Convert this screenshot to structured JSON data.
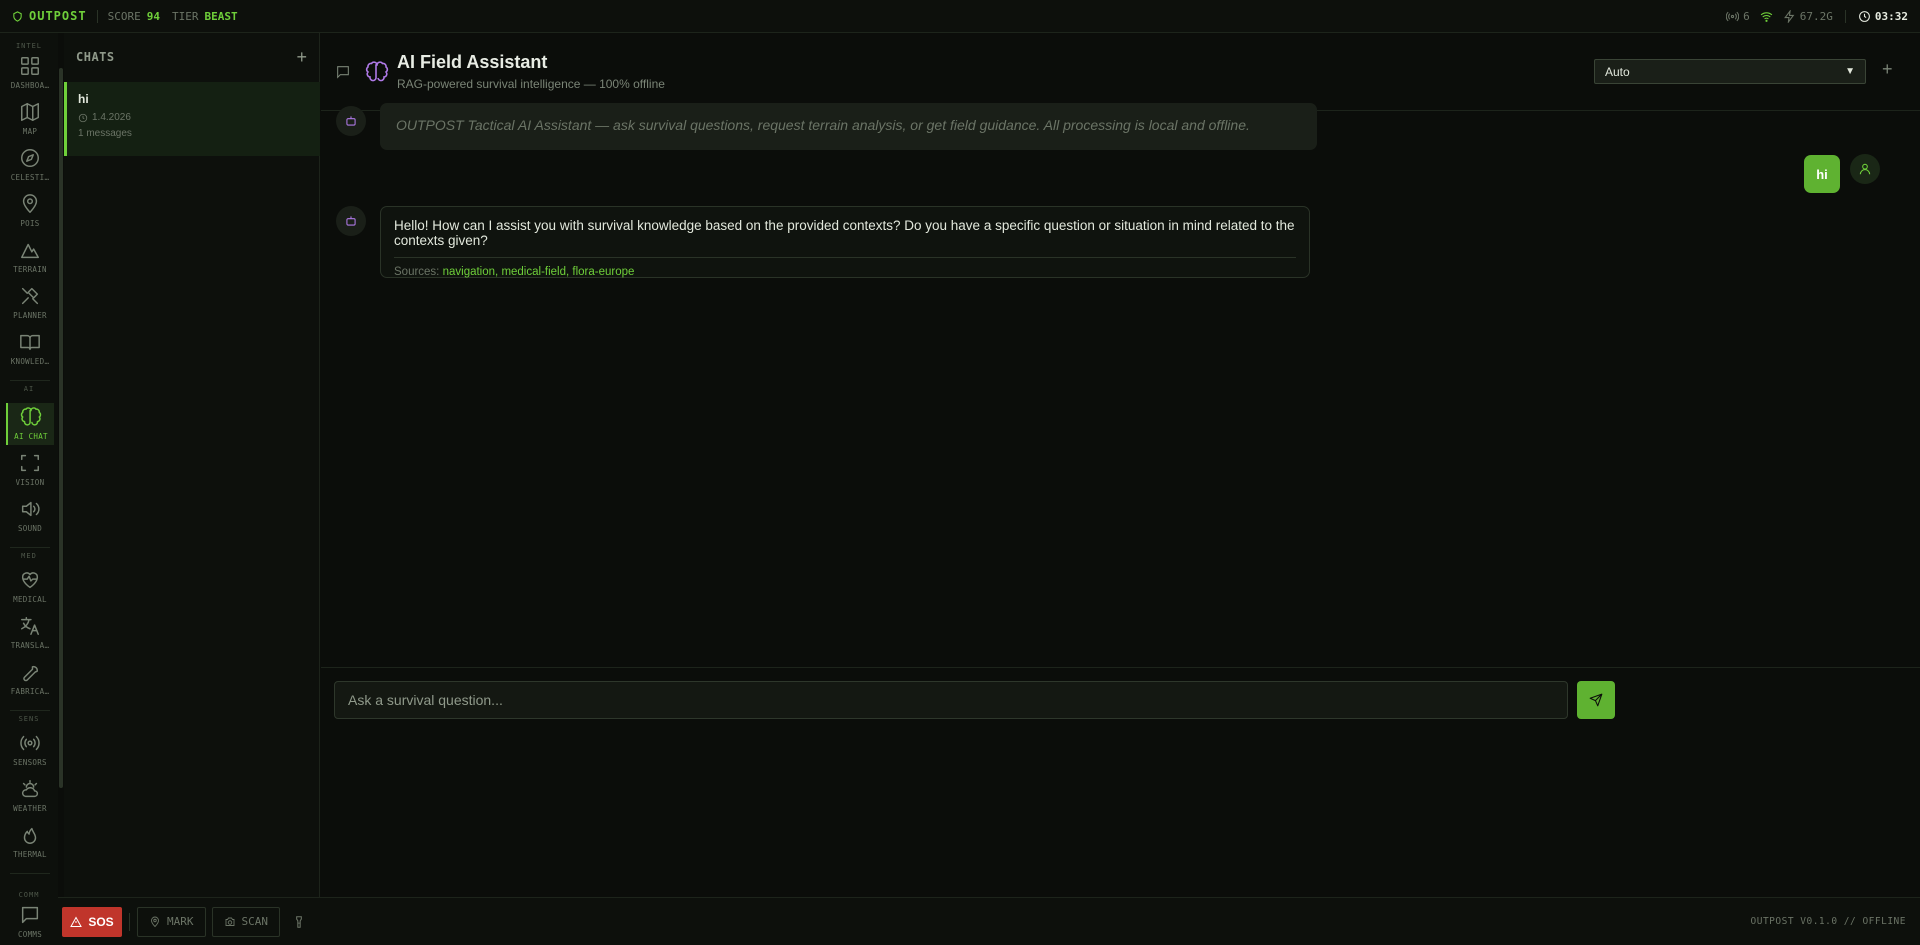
{
  "topbar": {
    "brand": "OUTPOST",
    "score_label": "SCORE",
    "score_value": "94",
    "tier_label": "TIER",
    "tier_value": "BEAST",
    "signal_count": "6",
    "power": "67.2G",
    "time": "03:32"
  },
  "rail": {
    "sections": [
      "INTEL",
      "AI",
      "MED",
      "SENS",
      "COMM"
    ],
    "items": [
      {
        "label": "DASHBOA…",
        "icon": "dashboard-icon"
      },
      {
        "label": "MAP",
        "icon": "map-icon"
      },
      {
        "label": "CELESTI…",
        "icon": "compass-icon"
      },
      {
        "label": "POIS",
        "icon": "pin-icon"
      },
      {
        "label": "TERRAIN",
        "icon": "mountain-icon"
      },
      {
        "label": "PLANNER",
        "icon": "tools-icon"
      },
      {
        "label": "KNOWLED…",
        "icon": "book-icon"
      },
      {
        "label": "AI CHAT",
        "icon": "brain-icon"
      },
      {
        "label": "VISION",
        "icon": "scan-icon"
      },
      {
        "label": "SOUND",
        "icon": "speaker-icon"
      },
      {
        "label": "MEDICAL",
        "icon": "heart-pulse-icon"
      },
      {
        "label": "TRANSLA…",
        "icon": "translate-icon"
      },
      {
        "label": "FABRICA…",
        "icon": "wrench-icon"
      },
      {
        "label": "SENSORS",
        "icon": "radio-icon"
      },
      {
        "label": "WEATHER",
        "icon": "cloud-sun-icon"
      },
      {
        "label": "THERMAL",
        "icon": "flame-icon"
      },
      {
        "label": "COMMS",
        "icon": "message-icon"
      }
    ]
  },
  "chats": {
    "title": "CHATS",
    "add": "+",
    "entries": [
      {
        "name": "hi",
        "date": "1.4.2026",
        "count": "1 messages"
      }
    ]
  },
  "header": {
    "title": "AI Field Assistant",
    "subtitle": "RAG-powered survival intelligence — 100% offline",
    "model": "Auto",
    "add": "+"
  },
  "messages": {
    "system": "OUTPOST Tactical AI Assistant — ask survival questions, request terrain analysis, or get field guidance. All processing is local and offline.",
    "user": "hi",
    "bot": "Hello! How can I assist you with survival knowledge based on the provided contexts? Do you have a specific question or situation in mind related to the contexts given?",
    "sources_label": "Sources:",
    "sources": [
      "navigation",
      "medical-field",
      "flora-europe"
    ]
  },
  "input": {
    "placeholder": "Ask a survival question..."
  },
  "bottombar": {
    "sos": "SOS",
    "mark": "MARK",
    "scan": "SCAN",
    "version": "OUTPOST V0.1.0 // OFFLINE"
  },
  "colors": {
    "accent": "#6fcf3a",
    "brain": "#b07ae8",
    "danger": "#c0352b",
    "background": "#0b0d0a"
  }
}
